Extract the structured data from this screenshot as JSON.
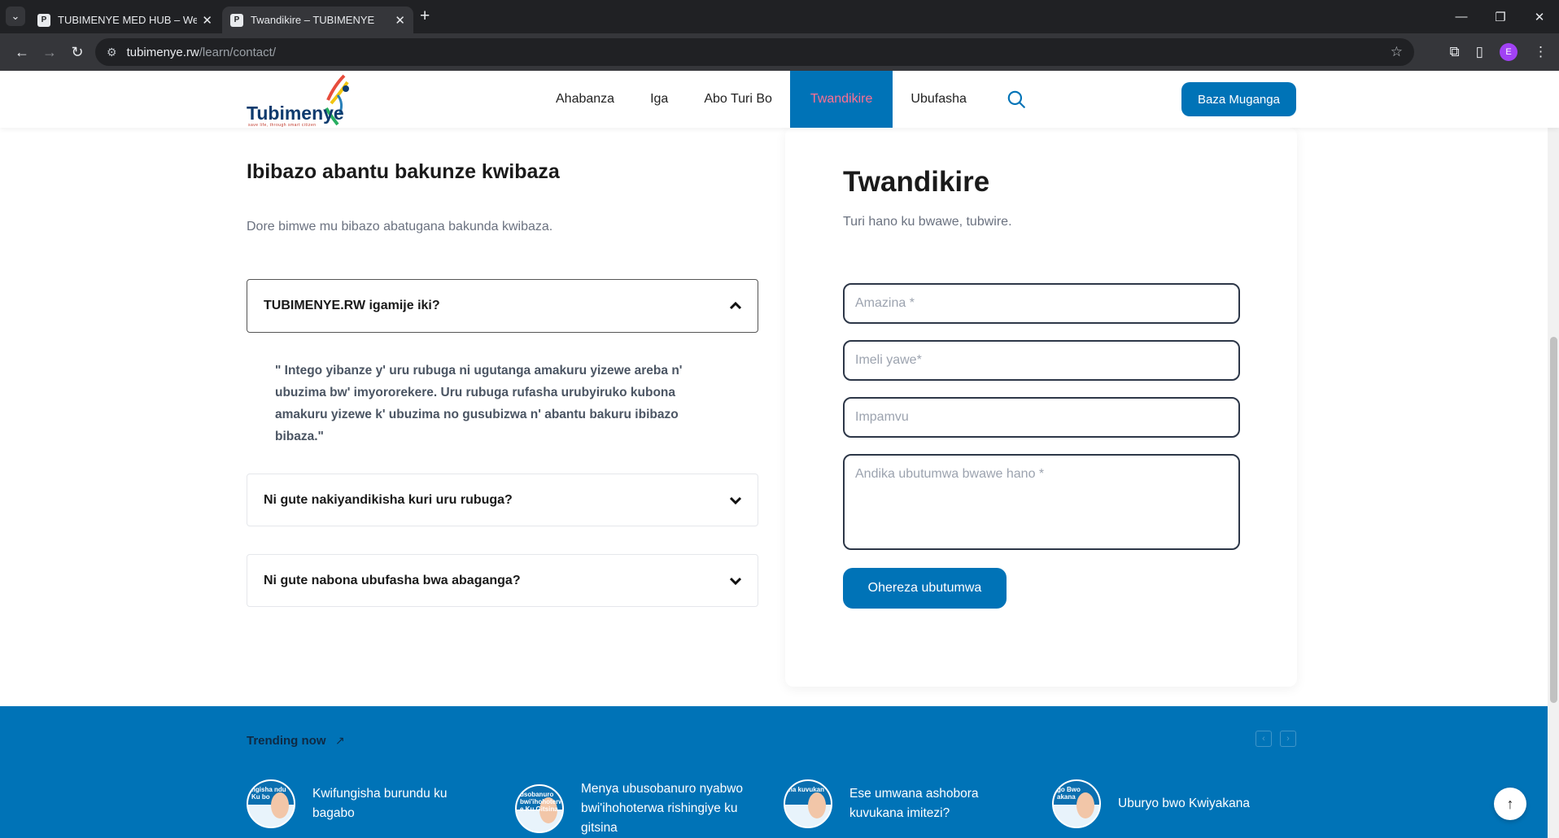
{
  "browser": {
    "tabs": [
      {
        "title": "TUBIMENYE MED HUB – We Ed",
        "active": false
      },
      {
        "title": "Twandikire – TUBIMENYE",
        "active": true
      }
    ],
    "url_host": "tubimenye.rw",
    "url_path": "/learn/contact/",
    "profile_initial": "E"
  },
  "site": {
    "logo_text": "Tubimenye",
    "logo_tagline": "save life, through smart citizen",
    "nav": [
      "Ahabanza",
      "Iga",
      "Abo Turi Bo",
      "Twandikire",
      "Ubufasha"
    ],
    "active_nav": "Twandikire",
    "cta_label": "Baza Muganga",
    "accent_color": "#0073b7",
    "active_text_color": "#ff6f91"
  },
  "faq": {
    "heading": "Ibibazo abantu bakunze kwibaza",
    "subheading": "Dore bimwe mu bibazo abatugana bakunda kwibaza.",
    "items": [
      {
        "question": "TUBIMENYE.RW igamije iki?",
        "expanded": true,
        "answer": "\" Intego yibanze y' uru rubuga ni ugutanga amakuru yizewe areba n' ubuzima bw' imyororekere. Uru rubuga rufasha urubyiruko kubona amakuru yizewe k' ubuzima no gusubizwa n' abantu bakuru ibibazo bibaza.\""
      },
      {
        "question": "Ni gute nakiyandikisha kuri uru rubuga?",
        "expanded": false
      },
      {
        "question": "Ni gute nabona ubufasha bwa abaganga?",
        "expanded": false
      }
    ]
  },
  "contact_form": {
    "title": "Twandikire",
    "subtitle": "Turi hano ku bwawe, tubwire.",
    "name_placeholder": "Amazina *",
    "email_placeholder": "Imeli yawe*",
    "subject_placeholder": "Impamvu",
    "message_placeholder": "Andika ubutumwa bwawe hano *",
    "submit_label": "Ohereza ubutumwa"
  },
  "trending": {
    "title": "Trending now",
    "items": [
      {
        "thumb_text": "ngisha ndu Ku bo",
        "title": "Kwifungisha burundu ku bagabo"
      },
      {
        "thumb_text": "usobanuro bwi'ihohoterwa e Ku Gitsina",
        "title": "Menya ubusobanuro nyabwo bwi'ihohoterwa rishingiye ku gitsina"
      },
      {
        "thumb_text": "na kuvukan",
        "title": "Ese umwana ashobora kuvukana imitezi?"
      },
      {
        "thumb_text": "go Bwo akana",
        "title": "Uburyo bwo Kwiyakana"
      }
    ]
  }
}
